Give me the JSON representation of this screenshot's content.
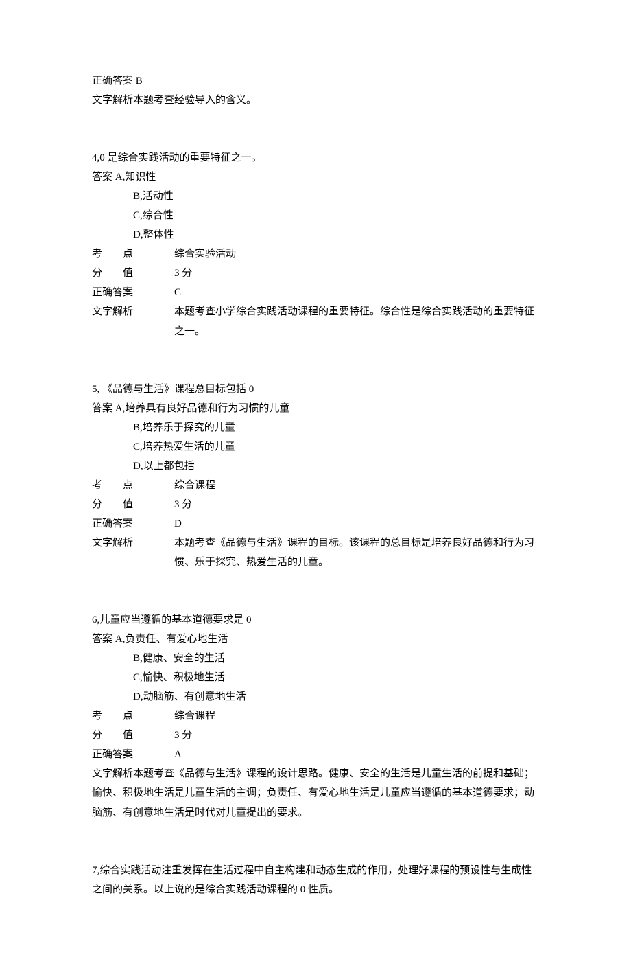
{
  "q3tail": {
    "correct_label": "正确答案",
    "correct_value": "B",
    "explain_label": "文字解析",
    "explain_text": "本题考查经验导入的含义。"
  },
  "q4": {
    "stem": "4,0 是综合实践活动的重要特征之一。",
    "ans_prefix": "答案",
    "opts": {
      "a": "A,知识性",
      "b": "B,活动性",
      "c": "C,综合性",
      "d": "D,整体性"
    },
    "point_label": "考点",
    "point_value": "综合实验活动",
    "score_label": "分值",
    "score_value": "3 分",
    "correct_label": "正确答案",
    "correct_value": "C",
    "explain_label": "文字解析",
    "explain_text": "本题考查小学综合实践活动课程的重要特征。综合性是综合实践活动的重要特征之一。"
  },
  "q5": {
    "stem": "5, 《品德与生活》课程总目标包括 0",
    "ans_prefix": "答案",
    "opts": {
      "a": "A,培养具有良好品德和行为习惯的儿童",
      "b": "B,培养乐于探究的儿童",
      "c": "C,培养热爱生活的儿童",
      "d": "D,以上都包括"
    },
    "point_label": "考点",
    "point_value": "综合课程",
    "score_label": "分值",
    "score_value": "3 分",
    "correct_label": "正确答案",
    "correct_value": "D",
    "explain_label": "文字解析",
    "explain_text": "本题考查《品德与生活》课程的目标。该课程的总目标是培养良好品德和行为习惯、乐于探究、热爱生活的儿童。"
  },
  "q6": {
    "stem": "6,儿童应当遵循的基本道德要求是 0",
    "ans_prefix": "答案",
    "opts": {
      "a": "A,负责任、有爱心地生活",
      "b": "B,健康、安全的生活",
      "c": "C,愉快、积极地生活",
      "d": "D,动脑筋、有创意地生活"
    },
    "point_label": "考点",
    "point_value": "综合课程",
    "score_label": "分值",
    "score_value": "3 分",
    "correct_label": "正确答案",
    "correct_value": "A",
    "explain_label": "文字解析",
    "explain_text": "本题考查《品德与生活》课程的设计思路。健康、安全的生活是儿童生活的前提和基础；愉快、积极地生活是儿童生活的主调；负责任、有爱心地生活是儿童应当遵循的基本道德要求；动脑筋、有创意地生活是时代对儿童提出的要求。"
  },
  "q7": {
    "stem": "7,综合实践活动注重发挥在生活过程中自主构建和动态生成的作用，处理好课程的预设性与生成性之间的关系。以上说的是综合实践活动课程的 0 性质。"
  }
}
